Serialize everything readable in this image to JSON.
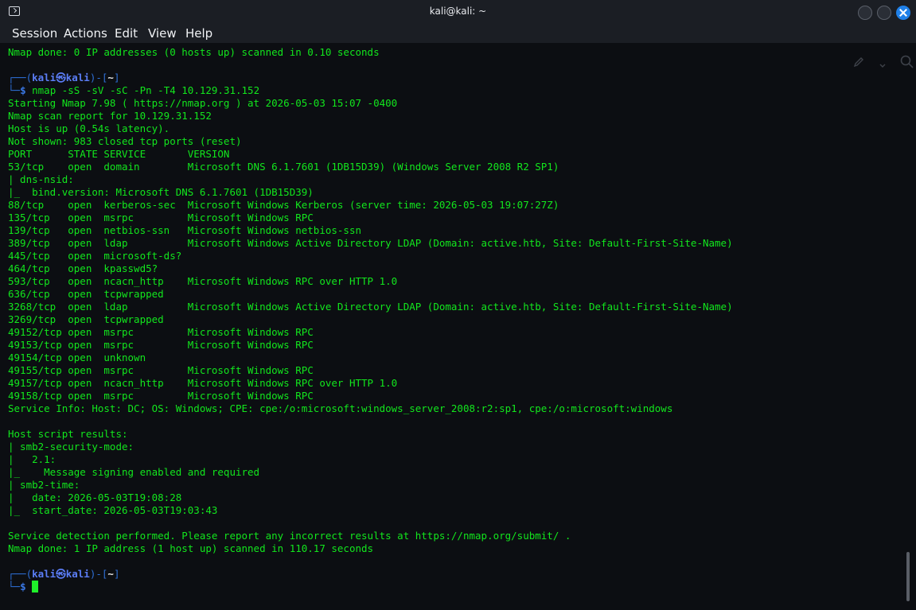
{
  "window": {
    "title": "kali@kali: ~"
  },
  "menu": {
    "items": [
      "Session",
      "Actions",
      "Edit",
      "View",
      "Help"
    ]
  },
  "toolbar_icons": [
    "pencil-icon",
    "chevron-down-icon",
    "search-icon"
  ],
  "prompt": {
    "frame_top": "┌──(",
    "user_host": "kali㉿kali",
    "mid": ")-[",
    "path": "~",
    "end": "]",
    "frame_bottom": "└─",
    "dollar": "$ "
  },
  "terminal": {
    "first_line": "Nmap done: 0 IP addresses (0 hosts up) scanned in 0.10 seconds",
    "command": "nmap -sS -sV -sC -Pn -T4 10.129.31.152",
    "output": [
      "Starting Nmap 7.98 ( https://nmap.org ) at 2026-05-03 15:07 -0400",
      "Nmap scan report for 10.129.31.152",
      "Host is up (0.54s latency).",
      "Not shown: 983 closed tcp ports (reset)",
      "PORT      STATE SERVICE       VERSION",
      "53/tcp    open  domain        Microsoft DNS 6.1.7601 (1DB15D39) (Windows Server 2008 R2 SP1)",
      "| dns-nsid:",
      "|_  bind.version: Microsoft DNS 6.1.7601 (1DB15D39)",
      "88/tcp    open  kerberos-sec  Microsoft Windows Kerberos (server time: 2026-05-03 19:07:27Z)",
      "135/tcp   open  msrpc         Microsoft Windows RPC",
      "139/tcp   open  netbios-ssn   Microsoft Windows netbios-ssn",
      "389/tcp   open  ldap          Microsoft Windows Active Directory LDAP (Domain: active.htb, Site: Default-First-Site-Name)",
      "445/tcp   open  microsoft-ds?",
      "464/tcp   open  kpasswd5?",
      "593/tcp   open  ncacn_http    Microsoft Windows RPC over HTTP 1.0",
      "636/tcp   open  tcpwrapped",
      "3268/tcp  open  ldap          Microsoft Windows Active Directory LDAP (Domain: active.htb, Site: Default-First-Site-Name)",
      "3269/tcp  open  tcpwrapped",
      "49152/tcp open  msrpc         Microsoft Windows RPC",
      "49153/tcp open  msrpc         Microsoft Windows RPC",
      "49154/tcp open  unknown",
      "49155/tcp open  msrpc         Microsoft Windows RPC",
      "49157/tcp open  ncacn_http    Microsoft Windows RPC over HTTP 1.0",
      "49158/tcp open  msrpc         Microsoft Windows RPC",
      "Service Info: Host: DC; OS: Windows; CPE: cpe:/o:microsoft:windows_server_2008:r2:sp1, cpe:/o:microsoft:windows",
      "",
      "Host script results:",
      "| smb2-security-mode:",
      "|   2.1:",
      "|_    Message signing enabled and required",
      "| smb2-time:",
      "|   date: 2026-05-03T19:08:28",
      "|_  start_date: 2026-05-03T19:03:43",
      "",
      "Service detection performed. Please report any incorrect results at https://nmap.org/submit/ .",
      "Nmap done: 1 IP address (1 host up) scanned in 110.17 seconds"
    ]
  },
  "colors": {
    "output_green": "#12e61d",
    "prompt_blue": "#2e6fd6",
    "close_button": "#1f80e8"
  }
}
